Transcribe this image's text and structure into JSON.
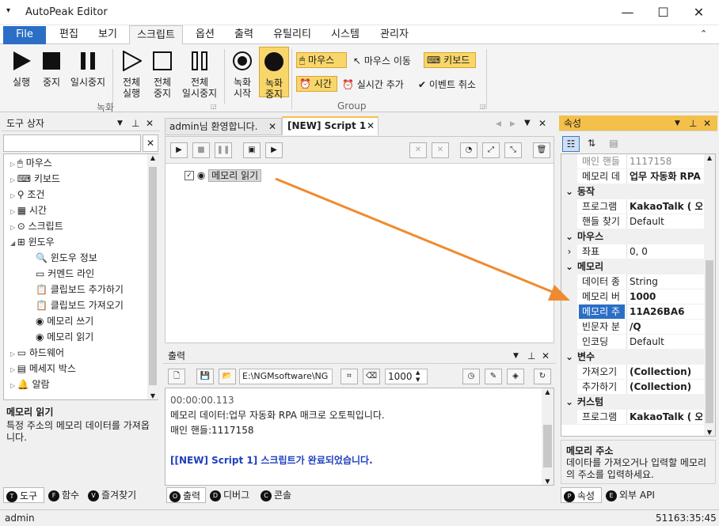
{
  "window": {
    "title": "AutoPeak Editor"
  },
  "menu": {
    "file": "File",
    "tabs": [
      "편집",
      "보기",
      "스크립트",
      "옵션",
      "출력",
      "유틸리티",
      "시스템",
      "관리자"
    ]
  },
  "ribbon": {
    "record_group": {
      "label": "녹화",
      "buttons": [
        "실행",
        "중지",
        "일시중지",
        "전체\n실행",
        "전체\n중지",
        "전체\n일시중지",
        "녹화\n시작",
        "녹화\n중지"
      ]
    },
    "group": {
      "label": "Group",
      "items": [
        "마우스",
        "마우스 이동",
        "키보드",
        "시간",
        "실시간 추가",
        "이벤트 취소"
      ]
    }
  },
  "toolbox": {
    "title": "도구 상자",
    "items": [
      {
        "label": "마우스",
        "level": 0
      },
      {
        "label": "키보드",
        "level": 0
      },
      {
        "label": "조건",
        "level": 0
      },
      {
        "label": "시간",
        "level": 0
      },
      {
        "label": "스크립트",
        "level": 0
      },
      {
        "label": "윈도우",
        "level": 0
      },
      {
        "label": "윈도우 정보",
        "level": 1
      },
      {
        "label": "커멘드 라인",
        "level": 1
      },
      {
        "label": "클립보드 추가하기",
        "level": 1
      },
      {
        "label": "클립보드 가져오기",
        "level": 1
      },
      {
        "label": "메모리 쓰기",
        "level": 1
      },
      {
        "label": "메모리 읽기",
        "level": 1
      },
      {
        "label": "하드웨어",
        "level": 0
      },
      {
        "label": "메세지 박스",
        "level": 0
      },
      {
        "label": "알람",
        "level": 0
      }
    ],
    "desc_title": "메모리 읽기",
    "desc_text": "특정 주소의 메모리 데이터를 가져옵니다.",
    "bottom_tabs": [
      "도구",
      "함수",
      "즐겨찾기"
    ]
  },
  "editor": {
    "tabs": [
      "admin님 환영합니다.",
      "[NEW] Script 1"
    ],
    "script_node": "메모리 읽기"
  },
  "output": {
    "title": "출력",
    "path": "E:\\NGMsoftware\\NG",
    "count": "1000",
    "lines": [
      "00:00:00.113",
      "메모리 데이터:업무 자동화 RPA 매크로 오토픽입니다.",
      "매인 핸들:1117158",
      "",
      "[[NEW] Script 1] 스크립트가 완료되었습니다."
    ],
    "bottom_tabs": [
      "출력",
      "디버그",
      "콘솔"
    ]
  },
  "properties": {
    "title": "속성",
    "rows": [
      {
        "type": "row",
        "key": "매인 핸들",
        "value": "1117158",
        "dim": true
      },
      {
        "type": "row",
        "key": "메모리 데",
        "value": "업무 자동화 RPA",
        "bold": true
      },
      {
        "type": "cat",
        "key": "동작"
      },
      {
        "type": "row",
        "key": "프로그램",
        "value": "KakaoTalk ( 오토",
        "bold": true
      },
      {
        "type": "row",
        "key": "핸들 찾기",
        "value": "Default"
      },
      {
        "type": "cat",
        "key": "마우스"
      },
      {
        "type": "row",
        "key": "좌표",
        "value": "0, 0",
        "expand": true
      },
      {
        "type": "cat",
        "key": "메모리"
      },
      {
        "type": "row",
        "key": "데이터 종",
        "value": "String"
      },
      {
        "type": "row",
        "key": "메모리 버",
        "value": "1000",
        "bold": true
      },
      {
        "type": "row",
        "key": "메모리 주",
        "value": "11A26BA6",
        "bold": true,
        "selected": true
      },
      {
        "type": "row",
        "key": "빈문자 분",
        "value": "/Q",
        "bold": true
      },
      {
        "type": "row",
        "key": "인코딩",
        "value": "Default"
      },
      {
        "type": "cat",
        "key": "변수"
      },
      {
        "type": "row",
        "key": "가져오기",
        "value": "(Collection)",
        "bold": true
      },
      {
        "type": "row",
        "key": "추가하기",
        "value": "(Collection)",
        "bold": true
      },
      {
        "type": "cat",
        "key": "커스텀"
      },
      {
        "type": "row",
        "key": "프로그램",
        "value": "KakaoTalk ( 오토",
        "bold": true
      }
    ],
    "desc_title": "메모리 주소",
    "desc_text": "데이타를 가져오거나 입력할 메모리의 주소를 입력하세요.",
    "bottom_tabs": [
      "속성",
      "외부 API"
    ]
  },
  "status": {
    "user": "admin",
    "time": "51163:35:45"
  },
  "colors": {
    "accent": "#2b6ec6",
    "highlight": "#f8d66a",
    "arrow": "#f08a30",
    "link": "#1f3fbf"
  }
}
